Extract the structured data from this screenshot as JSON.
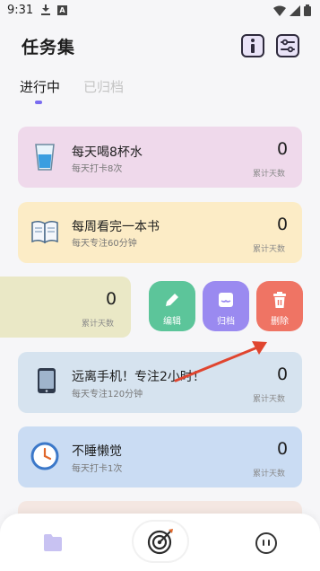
{
  "status_bar": {
    "time": "9:31"
  },
  "header": {
    "title": "任务集"
  },
  "tabs": [
    {
      "label": "进行中",
      "active": true
    },
    {
      "label": "已归档",
      "active": false
    }
  ],
  "tasks": [
    {
      "title": "每天喝8杯水",
      "subtitle": "每天打卡8次",
      "count": "0",
      "count_label": "累计天数",
      "icon": "water-glass-icon",
      "bg": "#efd9eb"
    },
    {
      "title": "每周看完一本书",
      "subtitle": "每天专注60分钟",
      "count": "0",
      "count_label": "累计天数",
      "icon": "book-icon",
      "bg": "#fcecc6"
    },
    {
      "title": "",
      "subtitle": "",
      "count": "0",
      "count_label": "累计天数",
      "icon": "",
      "bg": "#eae8c6"
    },
    {
      "title": "远离手机！专注2小时！",
      "subtitle": "每天专注120分钟",
      "count": "0",
      "count_label": "累计天数",
      "icon": "phone-icon",
      "bg": "#d6e3ef"
    },
    {
      "title": "不睡懒觉",
      "subtitle": "每天打卡1次",
      "count": "0",
      "count_label": "累计天数",
      "icon": "clock-icon",
      "bg": "#cadcf3"
    }
  ],
  "actions": [
    {
      "label": "编辑",
      "icon": "pencil-icon",
      "color": "#5cc59a"
    },
    {
      "label": "归档",
      "icon": "archive-icon",
      "color": "#9a8af0"
    },
    {
      "label": "删除",
      "icon": "trash-icon",
      "color": "#ef7464"
    }
  ],
  "annotation": {
    "arrow_color": "#e0452f"
  },
  "bottom_nav": {
    "items": [
      "folder-icon",
      "target-icon",
      "face-icon"
    ]
  }
}
